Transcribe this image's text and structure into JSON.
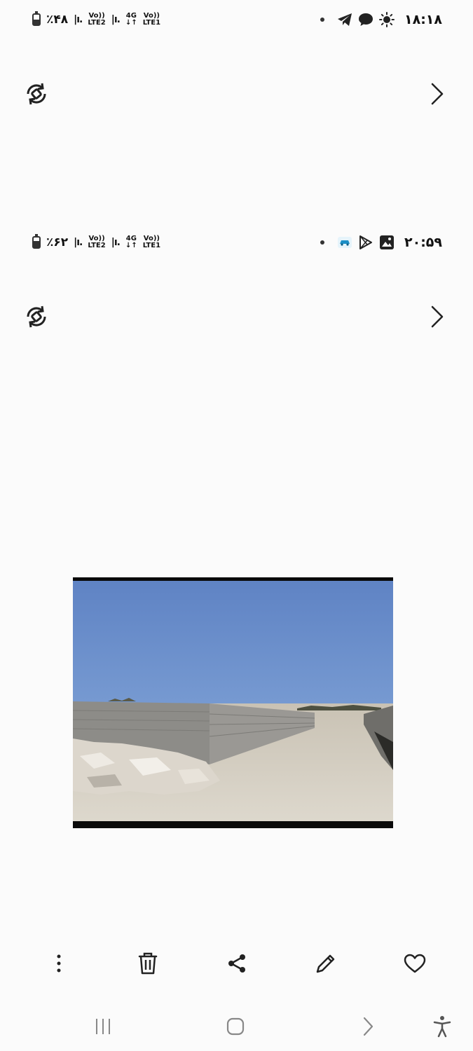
{
  "status_bar_1": {
    "battery_percent": "٪۴۸",
    "battery_level": 0.48,
    "sim2": {
      "top": "Vo))",
      "bottom": "LTE2"
    },
    "sim1": {
      "top": "4G",
      "mid": "↓↑",
      "vo": "Vo))",
      "lte": "LTE1"
    },
    "time": "۱۸:۱۸",
    "icons": [
      "dot-icon",
      "telegram-icon",
      "chat-bubble-icon",
      "brightness-icon"
    ]
  },
  "status_bar_2": {
    "battery_percent": "٪۶۲",
    "battery_level": 0.62,
    "sim2": {
      "top": "Vo))",
      "bottom": "LTE2"
    },
    "sim1": {
      "top": "4G",
      "mid": "↓↑",
      "vo": "Vo))",
      "lte": "LTE1"
    },
    "time": "۲۰:۵۹",
    "icons": [
      "dot-icon",
      "car-app-icon",
      "play-store-icon",
      "gallery-icon"
    ]
  },
  "viewer": {
    "photo_description_icon": "photo-construction-site",
    "controls": [
      "rotate-icon",
      "chevron-right-icon"
    ]
  },
  "toolbar": {
    "items": [
      "more-options-icon",
      "delete-icon",
      "share-icon",
      "edit-icon",
      "favorite-icon"
    ]
  },
  "navigation_bar": {
    "items": [
      "recent-apps-icon",
      "home-icon",
      "back-icon",
      "accessibility-icon"
    ]
  },
  "colors": {
    "background": "#fbfbfb",
    "icon": "#222222",
    "sky": "#6d8ec8"
  }
}
